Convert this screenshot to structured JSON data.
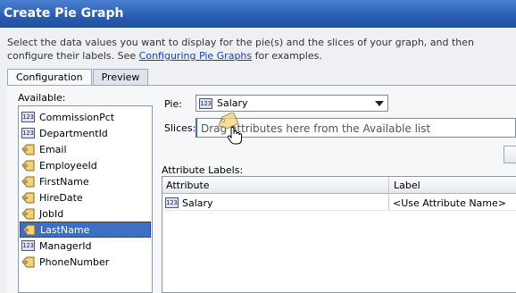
{
  "dialog": {
    "title": "Create Pie Graph",
    "description_prefix": "Select the data values you want to display for the pie(s) and the slices of your graph, and then configure their labels. See ",
    "description_link": "Configuring Pie Graphs",
    "description_suffix": " for examples."
  },
  "tabs": [
    {
      "label": "Configuration",
      "active": true
    },
    {
      "label": "Preview",
      "active": false
    }
  ],
  "available": {
    "label": "Available:",
    "items": [
      {
        "label": "CommissionPct",
        "icon": "number-attribute-icon",
        "selected": false
      },
      {
        "label": "DepartmentId",
        "icon": "number-attribute-icon",
        "selected": false
      },
      {
        "label": "Email",
        "icon": "tag-attribute-icon",
        "selected": false
      },
      {
        "label": "EmployeeId",
        "icon": "tag-attribute-icon",
        "selected": false
      },
      {
        "label": "FirstName",
        "icon": "tag-attribute-icon",
        "selected": false
      },
      {
        "label": "HireDate",
        "icon": "tag-attribute-icon",
        "selected": false
      },
      {
        "label": "JobId",
        "icon": "tag-attribute-icon",
        "selected": false
      },
      {
        "label": "LastName",
        "icon": "tag-attribute-icon",
        "selected": true
      },
      {
        "label": "ManagerId",
        "icon": "number-attribute-icon",
        "selected": false
      },
      {
        "label": "PhoneNumber",
        "icon": "tag-attribute-icon",
        "selected": false
      }
    ]
  },
  "pie": {
    "label": "Pie:",
    "value": "Salary",
    "icon_text": "123"
  },
  "slices": {
    "label": "Slices:",
    "placeholder": "Drag attributes here from the Available list"
  },
  "attribute_labels": {
    "label": "Attribute Labels:",
    "columns": [
      "Attribute",
      "Label"
    ],
    "rows": [
      {
        "attribute": "Salary",
        "label": "<Use Attribute Name>"
      }
    ]
  },
  "colors": {
    "title_bar": "#2b5fb4",
    "selection": "#3e6fc0",
    "link": "#1a3fb0"
  }
}
